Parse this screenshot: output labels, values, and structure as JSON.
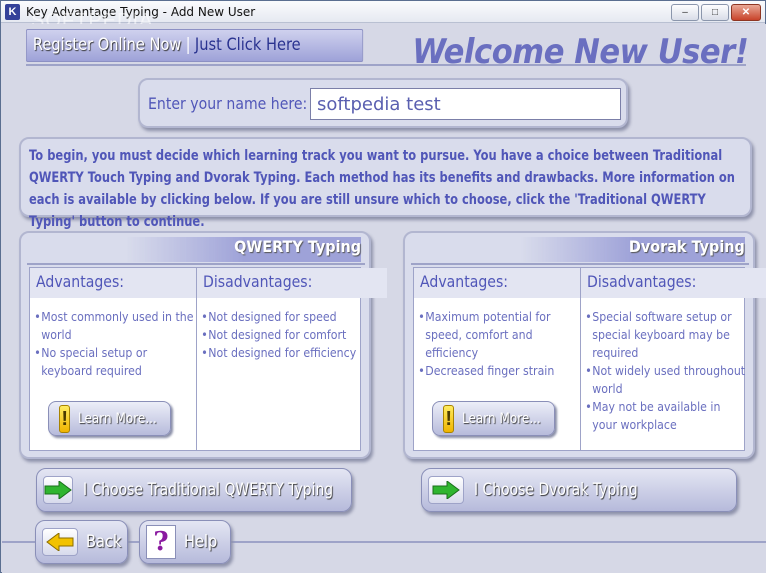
{
  "window": {
    "title": "Key Advantage Typing - Add New User",
    "app_icon_letter": "K",
    "watermark": "SOFTPEDIA",
    "buttons": {
      "minimize": "–",
      "maximize": "□",
      "close": "✕"
    }
  },
  "header": {
    "register_label": "Register Online Now",
    "separator": "|",
    "register_link": "Just Click Here",
    "welcome": "Welcome New User!"
  },
  "name_prompt": {
    "label": "Enter your name here:",
    "value": "softpedia test"
  },
  "intro": {
    "text": "To begin, you must decide which learning track you want to pursue. You have a choice between Traditional QWERTY Touch Typing and Dvorak Typing. Each method has its benefits and drawbacks. More information on each is available by clicking below. If you are still unsure which to choose, click the 'Traditional QWERTY Typing' button to continue."
  },
  "qwerty": {
    "title": "QWERTY Typing",
    "advantages_header": "Advantages:",
    "disadvantages_header": "Disadvantages:",
    "advantages": [
      "Most commonly used in the world",
      "No special setup or keyboard required"
    ],
    "disadvantages": [
      "Not designed for speed",
      "Not designed for comfort",
      "Not designed for efficiency"
    ],
    "learn_more": "Learn More...",
    "choose_label": "I Choose Traditional QWERTY Typing"
  },
  "dvorak": {
    "title": "Dvorak Typing",
    "advantages_header": "Advantages:",
    "disadvantages_header": "Disadvantages:",
    "advantages": [
      "Maximum potential for speed, comfort and efficiency",
      "Decreased finger strain"
    ],
    "disadvantages": [
      "Special software setup or special keyboard may be required",
      "Not widely used throughout world",
      "May not be available in your workplace"
    ],
    "learn_more": "Learn More...",
    "choose_label": "I Choose Dvorak Typing"
  },
  "footer": {
    "back_label": "Back",
    "help_label": "Help",
    "help_glyph": "?"
  },
  "colors": {
    "background": "#d6d8e6",
    "accent_text": "#5056b8",
    "panel": "#d9dcec",
    "arrow_green": "#2fb52f",
    "arrow_yellow": "#f2c200",
    "help_purple": "#8a1aa0"
  },
  "icons": {
    "learn_more": "exclamation-icon",
    "choose": "green-right-arrow-icon",
    "back": "yellow-left-arrow-icon",
    "help": "question-mark-icon"
  }
}
